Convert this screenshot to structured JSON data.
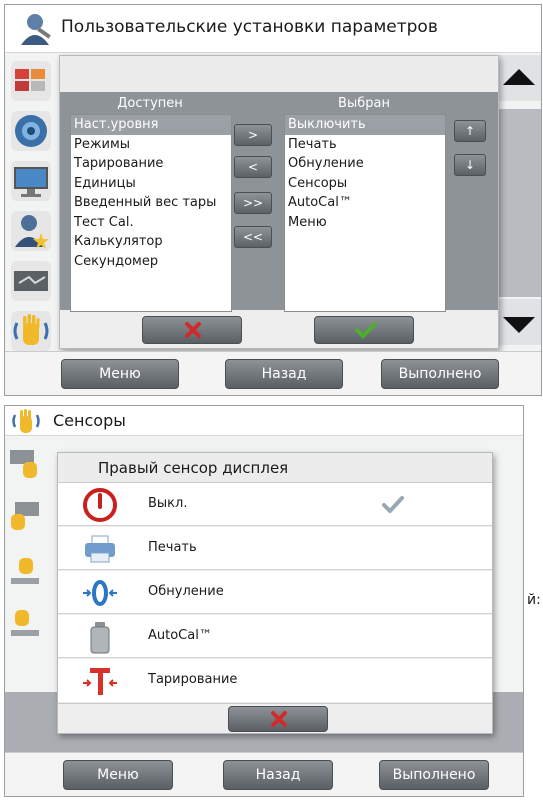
{
  "screen1": {
    "title": "Пользовательские установки параметров",
    "available": {
      "header": "Доступен",
      "items": [
        "Наст.уровня",
        "Режимы",
        "Тарирование",
        "Единицы",
        "Введенный вес тары",
        "Тест Cal.",
        "Калькулятор",
        "Секундомер"
      ]
    },
    "selected": {
      "header": "Выбран",
      "items": [
        "Выключить",
        "Печать",
        "Обнуление",
        "Сенсоры",
        "AutoCal™",
        "Меню"
      ]
    },
    "move_buttons": [
      ">",
      "<",
      ">>",
      "<<"
    ],
    "order_buttons": [
      "↑",
      "↓"
    ],
    "footer": {
      "menu": "Меню",
      "back": "Назад",
      "done": "Выполнено"
    }
  },
  "screen2": {
    "title": "Сенсоры",
    "dialog_title": "Правый сенсор дисплея",
    "options": [
      {
        "label": "Выкл.",
        "icon": "power-icon",
        "checked": true
      },
      {
        "label": "Печать",
        "icon": "printer-icon",
        "checked": false
      },
      {
        "label": "Обнуление",
        "icon": "zero-icon",
        "checked": false
      },
      {
        "label": "AutoCal™",
        "icon": "calibration-weight-icon",
        "checked": false
      },
      {
        "label": "Тарирование",
        "icon": "tare-icon",
        "checked": false
      }
    ],
    "footer": {
      "menu": "Меню",
      "back": "Назад",
      "done": "Выполнено"
    }
  },
  "side_label_fragment": "й:",
  "colors": {
    "accent_green": "#4caf2e",
    "cancel_red": "#d22a2a",
    "selection": "#9aa0a6",
    "panel_dark": "#8e9398"
  }
}
